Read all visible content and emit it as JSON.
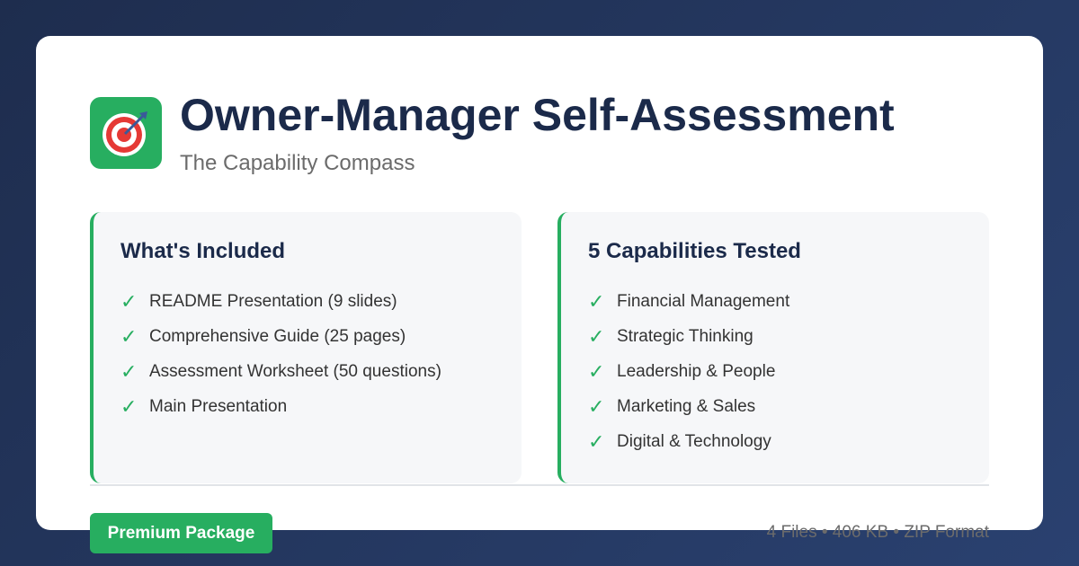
{
  "header": {
    "logo_icon": "target-dart-icon",
    "title": "Owner-Manager Self-Assessment",
    "subtitle": "The Capability Compass"
  },
  "included": {
    "title": "What's Included",
    "items": [
      "README Presentation (9 slides)",
      "Comprehensive Guide (25 pages)",
      "Assessment Worksheet (50 questions)",
      "Main Presentation"
    ]
  },
  "capabilities": {
    "title": "5 Capabilities Tested",
    "items": [
      "Financial Management",
      "Strategic Thinking",
      "Leadership & People",
      "Marketing & Sales",
      "Digital & Technology"
    ]
  },
  "footer": {
    "badge": "Premium Package",
    "meta": "4 Files • 406 KB • ZIP Format"
  },
  "check_symbol": "✓",
  "colors": {
    "accent": "#27ae60",
    "title": "#1b2a4a",
    "background_start": "#1e2d4e",
    "background_end": "#2a4170"
  }
}
